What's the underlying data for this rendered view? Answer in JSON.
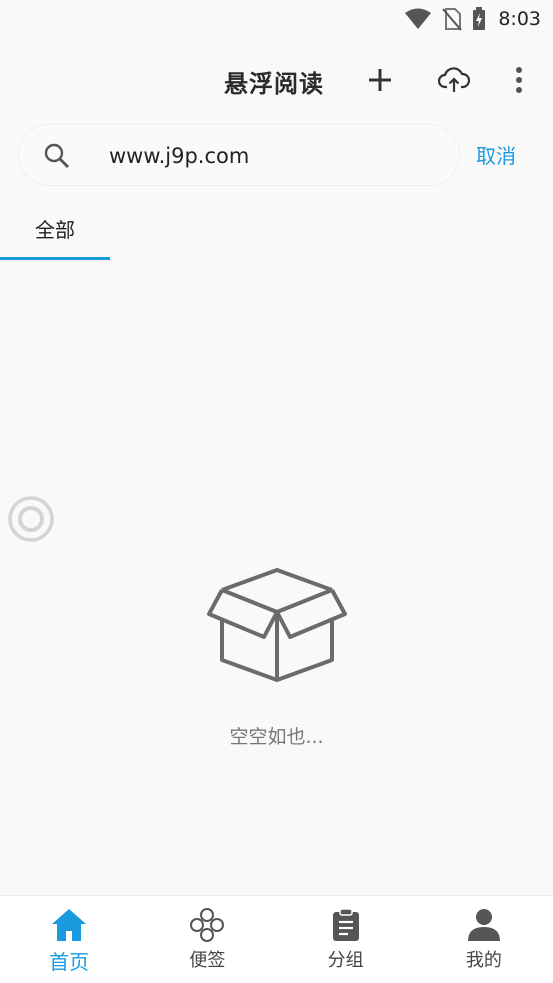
{
  "status": {
    "time": "8:03"
  },
  "header": {
    "title": "悬浮阅读"
  },
  "search": {
    "value": "www.j9p.com",
    "cancel_label": "取消"
  },
  "tabs": [
    {
      "label": "全部",
      "active": true
    }
  ],
  "empty": {
    "text": "空空如也..."
  },
  "bottom_nav": [
    {
      "label": "首页",
      "icon": "home-icon",
      "active": true
    },
    {
      "label": "便签",
      "icon": "clover-icon",
      "active": false
    },
    {
      "label": "分组",
      "icon": "clipboard-icon",
      "active": false
    },
    {
      "label": "我的",
      "icon": "person-icon",
      "active": false
    }
  ],
  "colors": {
    "accent": "#1a9be0",
    "icon": "#555555",
    "background": "#f9f9f9"
  }
}
